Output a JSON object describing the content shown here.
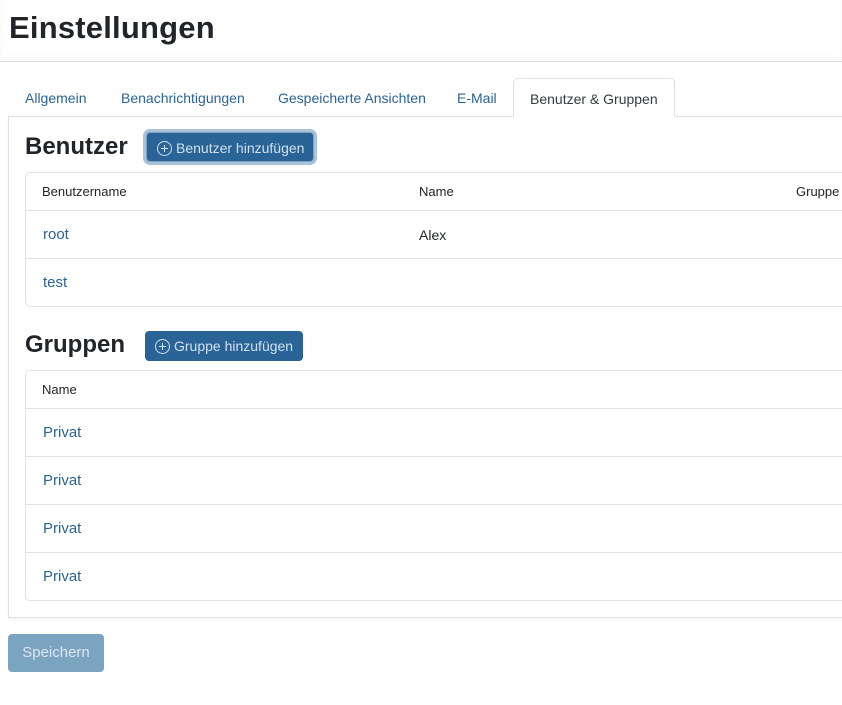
{
  "page": {
    "title": "Einstellungen"
  },
  "tabs": [
    {
      "label": "Allgemein",
      "active": false
    },
    {
      "label": "Benachrichtigungen",
      "active": false
    },
    {
      "label": "Gespeicherte Ansichten",
      "active": false
    },
    {
      "label": "E-Mail",
      "active": false
    },
    {
      "label": "Benutzer & Gruppen",
      "active": true
    }
  ],
  "users": {
    "title": "Benutzer",
    "add_button": "Benutzer hinzufügen",
    "columns": [
      "Benutzername",
      "Name",
      "Gruppe"
    ],
    "rows": [
      {
        "username": "root",
        "name": "Alex"
      },
      {
        "username": "test",
        "name": ""
      }
    ]
  },
  "groups": {
    "title": "Gruppen",
    "add_button": "Gruppe hinzufügen",
    "columns": [
      "Name"
    ],
    "rows": [
      {
        "name": "Privat"
      },
      {
        "name": "Privat"
      },
      {
        "name": "Privat"
      },
      {
        "name": "Privat"
      }
    ]
  },
  "footer": {
    "save_label": "Speichern"
  },
  "colors": {
    "accent": "#2a6496",
    "save_disabled": "#7ba4c1",
    "border": "#dee2e6"
  },
  "icons": {
    "add": "plus-circle-icon"
  }
}
